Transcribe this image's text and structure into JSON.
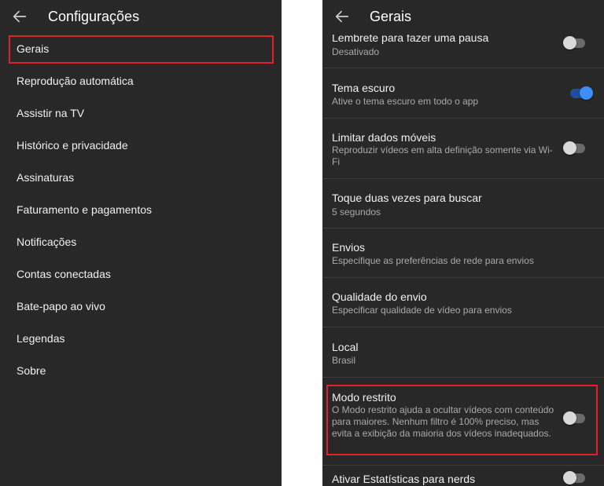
{
  "left_screen": {
    "title": "Configurações",
    "items": [
      {
        "label": "Gerais"
      },
      {
        "label": "Reprodução automática"
      },
      {
        "label": "Assistir na TV"
      },
      {
        "label": "Histórico e privacidade"
      },
      {
        "label": "Assinaturas"
      },
      {
        "label": "Faturamento e pagamentos"
      },
      {
        "label": "Notificações"
      },
      {
        "label": "Contas conectadas"
      },
      {
        "label": "Bate-papo ao vivo"
      },
      {
        "label": "Legendas"
      },
      {
        "label": "Sobre"
      }
    ]
  },
  "right_screen": {
    "title": "Gerais",
    "settings": [
      {
        "title": "Lembrete para fazer uma pausa",
        "subtitle": "Desativado",
        "toggle": "off"
      },
      {
        "title": "Tema escuro",
        "subtitle": "Ative o tema escuro em todo o app",
        "toggle": "on"
      },
      {
        "title": "Limitar dados móveis",
        "subtitle": "Reproduzir vídeos em alta definição somente via Wi-Fi",
        "toggle": "off"
      },
      {
        "title": "Toque duas vezes para buscar",
        "subtitle": "5 segundos"
      },
      {
        "title": "Envios",
        "subtitle": "Especifique as preferências de rede para envios"
      },
      {
        "title": "Qualidade do envio",
        "subtitle": "Especificar qualidade de vídeo para envios"
      },
      {
        "title": "Local",
        "subtitle": "Brasil"
      },
      {
        "title": "Modo restrito",
        "subtitle": "O Modo restrito ajuda a ocultar vídeos com conteúdo para maiores. Nenhum filtro é 100% preciso, mas evita a exibição da maioria dos vídeos inadequados.",
        "toggle": "off"
      },
      {
        "title": "Ativar Estatísticas para nerds",
        "toggle": "off"
      }
    ]
  },
  "colors": {
    "background": "#282828",
    "highlight": "#e0202a",
    "toggle_on": "#3e8ef7"
  },
  "icons": [
    "arrow-back-icon"
  ]
}
